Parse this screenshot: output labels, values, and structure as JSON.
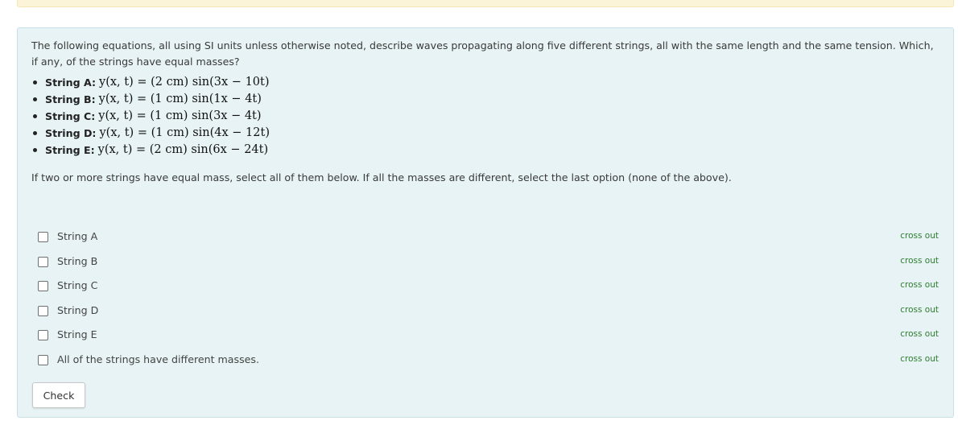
{
  "question": {
    "prompt": "The following equations, all using SI units unless otherwise noted, describe waves propagating along five different strings, all with the same length and the same tension. Which, if any, of the strings have equal masses?",
    "equations": [
      {
        "label": "String A:",
        "math": "y(x, t) = (2 cm) sin(3x − 10t)"
      },
      {
        "label": "String B:",
        "math": "y(x, t) = (1 cm) sin(1x − 4t)"
      },
      {
        "label": "String C:",
        "math": "y(x, t) = (1 cm) sin(3x − 4t)"
      },
      {
        "label": "String D:",
        "math": "y(x, t) = (1 cm) sin(4x − 12t)"
      },
      {
        "label": "String E:",
        "math": "y(x, t) = (2 cm) sin(6x − 24t)"
      }
    ],
    "instruction": "If two or more strings have equal mass, select all of them below. If all the masses are different, select the last option (none of the above)."
  },
  "options": [
    {
      "label": "String A",
      "cross_out": "cross out"
    },
    {
      "label": "String B",
      "cross_out": "cross out"
    },
    {
      "label": "String C",
      "cross_out": "cross out"
    },
    {
      "label": "String D",
      "cross_out": "cross out"
    },
    {
      "label": "String E",
      "cross_out": "cross out"
    },
    {
      "label": "All of the strings have different masses.",
      "cross_out": "cross out"
    }
  ],
  "check_button": "Check",
  "colors": {
    "panel_background": "#e7f3f5",
    "panel_border": "#c6e2e8",
    "notice_background": "#fcf4d8",
    "cross_out_text": "#2f7d2f"
  }
}
